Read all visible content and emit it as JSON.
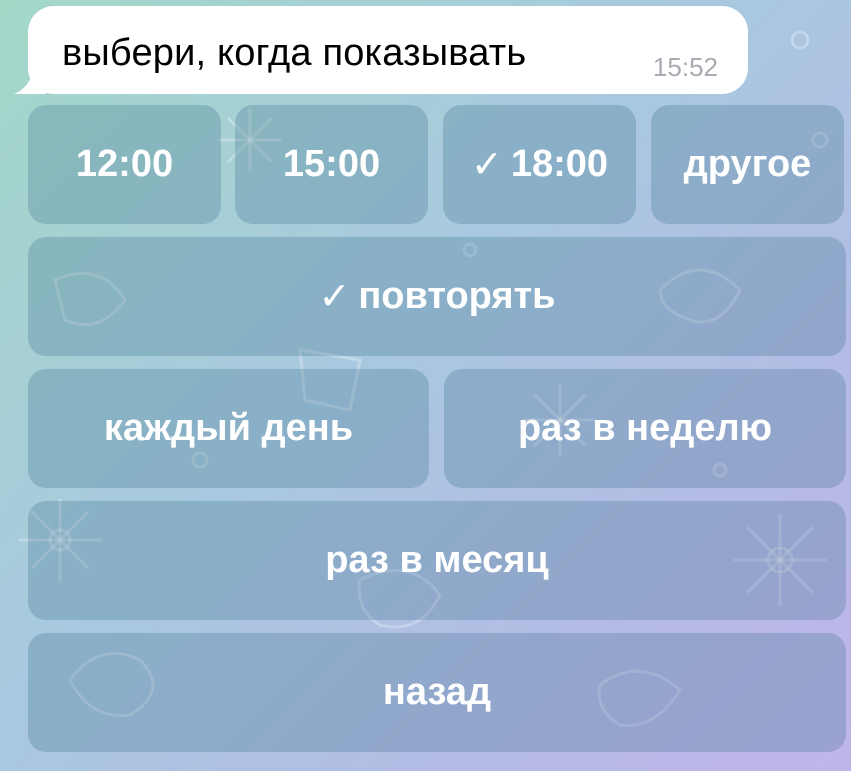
{
  "message": {
    "text": "выбери, когда показывать",
    "time": "15:52"
  },
  "keyboard": {
    "check_mark": "✓",
    "time_options": [
      {
        "label": "12:00",
        "checked": false
      },
      {
        "label": "15:00",
        "checked": false
      },
      {
        "label": "18:00",
        "checked": true
      },
      {
        "label": "другое",
        "checked": false
      }
    ],
    "repeat": {
      "label": "повторять",
      "checked": true
    },
    "every_day": "каждый день",
    "once_a_week": "раз в неделю",
    "once_a_month": "раз в месяц",
    "back": "назад"
  },
  "colors": {
    "background_start": "#a3d8c8",
    "background_end": "#c0b5ea",
    "bubble": "#ffffff",
    "time_text": "#a7acb2",
    "button_text": "#ffffff"
  }
}
